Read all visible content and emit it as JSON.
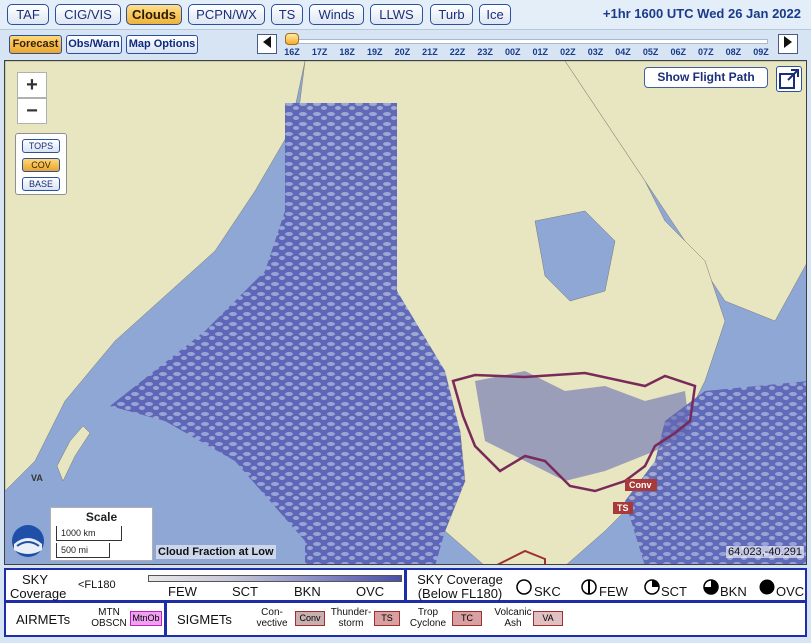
{
  "toolbar": {
    "tabs": [
      {
        "label": "TAF",
        "active": false
      },
      {
        "label": "CIG/VIS",
        "active": false
      },
      {
        "label": "Clouds",
        "active": true
      },
      {
        "label": "PCPN/WX",
        "active": false
      },
      {
        "label": "TS",
        "active": false
      },
      {
        "label": "Winds",
        "active": false
      },
      {
        "label": "LLWS",
        "active": false
      },
      {
        "label": "Turb",
        "active": false
      },
      {
        "label": "Ice",
        "active": false
      }
    ],
    "valid_time": "+1hr 1600 UTC Wed 26 Jan 2022"
  },
  "mode": {
    "buttons": [
      {
        "label": "Forecast",
        "active": true
      },
      {
        "label": "Obs/Warn",
        "active": false
      },
      {
        "label": "Map Options",
        "active": false
      }
    ]
  },
  "timeline": {
    "ticks": [
      "16Z",
      "17Z",
      "18Z",
      "19Z",
      "20Z",
      "21Z",
      "22Z",
      "23Z",
      "00Z",
      "01Z",
      "02Z",
      "03Z",
      "04Z",
      "05Z",
      "06Z",
      "07Z",
      "08Z",
      "09Z"
    ],
    "selected_index": 0,
    "prev_icon": "triangle-left-icon",
    "next_icon": "triangle-right-icon"
  },
  "map": {
    "zoom_in": "+",
    "zoom_out": "−",
    "layers": [
      {
        "label": "TOPS",
        "active": false
      },
      {
        "label": "COV",
        "active": true
      },
      {
        "label": "BASE",
        "active": false
      }
    ],
    "show_flight_path": "Show Flight Path",
    "expand_icon": "expand-icon",
    "scale": {
      "title": "Scale",
      "km": "1000 km",
      "mi": "500 mi"
    },
    "product_label": "Cloud Fraction at Low",
    "coordinates": "64.023,-40.291",
    "place_labels": [
      "VA",
      "Conv",
      "TS"
    ],
    "colors": {
      "ocean": "#8fa7d4",
      "land": "#e7e6c0",
      "cloud": "#4a4fa8",
      "sigmet": "#7a2a5a"
    }
  },
  "legend": {
    "sky_coverage_title": "SKY\nCoverage",
    "fl_label": "<FL180",
    "coverage_levels": [
      "FEW",
      "SCT",
      "BKN",
      "OVC"
    ],
    "sky_below_title": "SKY Coverage\n(Below FL180)",
    "symbols": [
      "SKC",
      "FEW",
      "SCT",
      "BKN",
      "OVC"
    ],
    "airmets_label": "AIRMETs",
    "mtn_obscn": "MTN\nOBSCN",
    "mtn_box": "MtnOb",
    "sigmets_label": "SIGMETs",
    "sigmet_items": [
      {
        "label": "Con-\nvective",
        "box": "Conv"
      },
      {
        "label": "Thunder-\nstorm",
        "box": "TS"
      },
      {
        "label": "Trop\nCyclone",
        "box": "TC"
      },
      {
        "label": "Volcanic\nAsh",
        "box": "VA"
      }
    ]
  }
}
